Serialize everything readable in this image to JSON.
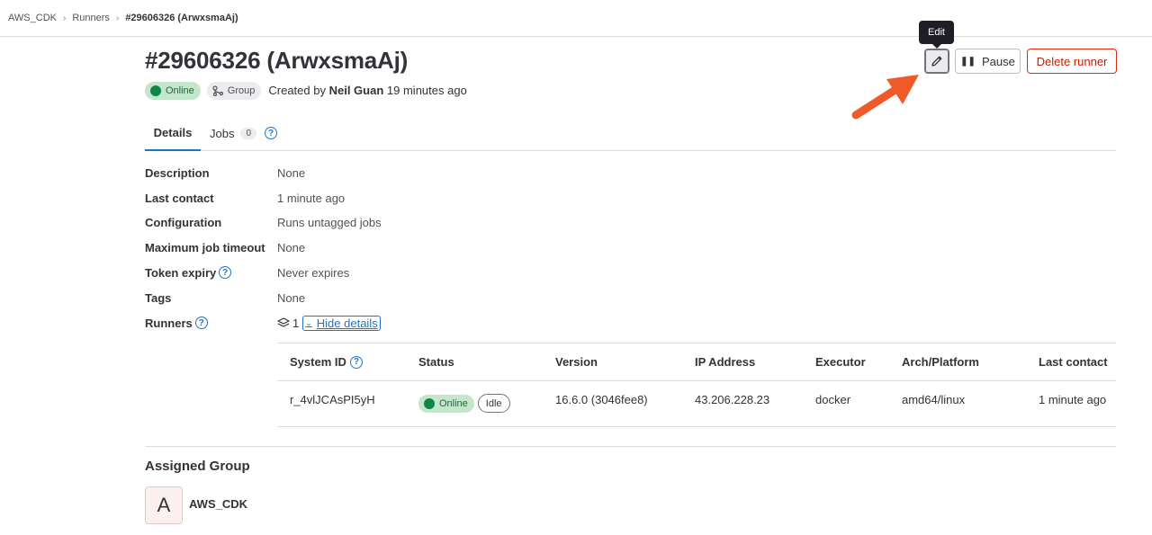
{
  "breadcrumb": {
    "items": [
      "AWS_CDK",
      "Runners",
      "#29606326 (ArwxsmaAj)"
    ]
  },
  "header": {
    "title": "#29606326 (ArwxsmaAj)",
    "status_badge": "Online",
    "type_badge": "Group",
    "created_prefix": "Created by",
    "created_by": "Neil Guan",
    "created_time": "19 minutes ago",
    "edit_tooltip": "Edit",
    "pause_label": "Pause",
    "delete_label": "Delete runner"
  },
  "tabs": {
    "details": "Details",
    "jobs": "Jobs",
    "jobs_count": "0"
  },
  "details": {
    "rows": [
      {
        "label": "Description",
        "value": "None"
      },
      {
        "label": "Last contact",
        "value": "1 minute ago"
      },
      {
        "label": "Configuration",
        "value": "Runs untagged jobs"
      },
      {
        "label": "Maximum job timeout",
        "value": "None"
      },
      {
        "label": "Token expiry",
        "value": "Never expires"
      },
      {
        "label": "Tags",
        "value": "None"
      },
      {
        "label": "Runners",
        "value": "1"
      }
    ],
    "hide_details": "Hide details"
  },
  "runners_table": {
    "headers": [
      "System ID",
      "Status",
      "Version",
      "IP Address",
      "Executor",
      "Arch/Platform",
      "Last contact"
    ],
    "row": {
      "system_id": "r_4vlJCAsPI5yH",
      "status": "Online",
      "state": "Idle",
      "version": "16.6.0 (3046fee8)",
      "ip": "43.206.228.23",
      "executor": "docker",
      "arch": "amd64/linux",
      "last_contact": "1 minute ago"
    }
  },
  "assigned_group": {
    "title": "Assigned Group",
    "avatar_letter": "A",
    "name": "AWS_CDK"
  },
  "colors": {
    "accent": "#1f75cb",
    "danger": "#dd2b0e",
    "online": "#108548",
    "annotation_arrow": "#f05a28"
  }
}
